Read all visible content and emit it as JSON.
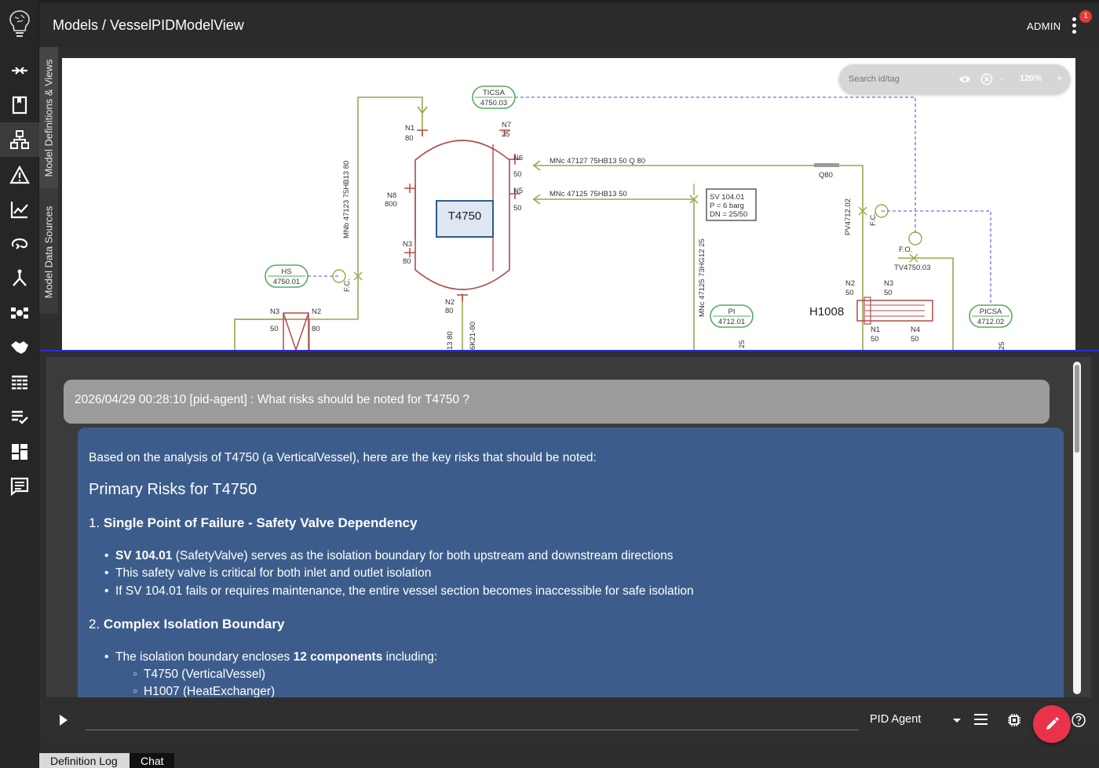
{
  "header": {
    "breadcrumb": "Models / VesselPIDModelView",
    "user": "ADMIN",
    "notification_count": "1"
  },
  "side_tabs": {
    "definitions": "Model Definitions & Views",
    "data_sources": "Model Data Sources"
  },
  "rail_icons": [
    "brain-logo-icon",
    "compare-arrows-icon",
    "book-icon",
    "hierarchy-icon",
    "warning-icon",
    "line-chart-icon",
    "loop-icon",
    "fork-icon",
    "graph-nodes-icon",
    "handshake-icon",
    "table-icon",
    "checklist-icon",
    "dashboard-icon",
    "comment-icon"
  ],
  "diagram_toolbar": {
    "search_placeholder": "Search id/tag",
    "zoom_out": "-",
    "zoom": "120%",
    "zoom_in": "+"
  },
  "diagram": {
    "tags": {
      "ticsa": [
        "TICSA",
        "4750.03"
      ],
      "hs": [
        "HS",
        "4750.01"
      ],
      "pi": [
        "PI",
        "4712.01"
      ],
      "picsa": [
        "PICSA",
        "4712.02"
      ]
    },
    "vessel_label": "T4750",
    "exchanger_label": "H1008",
    "sv_box": [
      "SV 104.01",
      "P = 6 barg",
      "DN = 25/50"
    ],
    "texts": {
      "n1": "N1",
      "n1v": "80",
      "n7": "N7",
      "n7v": "25",
      "n6": "N6",
      "n6v": "50",
      "n5": "N5",
      "n5v": "50",
      "n8": "N8",
      "n8v": "800",
      "n3": "N3",
      "n3v": "80",
      "n2": "N2",
      "n2v": "80",
      "line1": "MNc 47127 75HB13 50 Q 80",
      "line2": "MNc 47125 75HB13 50",
      "line_v1": "MNb 47123 75HB13 80",
      "line_v2": "MNc 47125 73HG12 25",
      "q80": "Q80",
      "pv": "PV4712.02",
      "fc": "F.C.",
      "fo": "F.O.",
      "tv": "TV4750.03",
      "h_n2": "N2",
      "h_n2v": "50",
      "h_n3": "N3",
      "h_n3v": "50",
      "h_n1": "N1",
      "h_n1v": "50",
      "h_n4": "N4",
      "h_n4v": "50",
      "l_n3": "N3",
      "l_n3v": "50",
      "l_n2": "N2",
      "l_n2v": "80",
      "b25a": "25",
      "b25b": "25",
      "b13": "13 80",
      "b6k": "6K21-80"
    }
  },
  "chat": {
    "question": "2026/04/29 00:28:10 [pid-agent] : What risks should be noted for T4750 ?",
    "answer": {
      "intro": "Based on the analysis of T4750 (a VerticalVessel), here are the key risks that should be noted:",
      "heading": "Primary Risks for T4750",
      "section1": {
        "num": "1.",
        "title": "Single Point of Failure - Safety Valve Dependency",
        "b1_bold": "SV 104.01",
        "b1_rest": " (SafetyValve) serves as the isolation boundary for both upstream and downstream directions",
        "b2": "This safety valve is critical for both inlet and outlet isolation",
        "b3": "If SV 104.01 fails or requires maintenance, the entire vessel section becomes inaccessible for safe isolation"
      },
      "section2": {
        "num": "2.",
        "title": "Complex Isolation Boundary",
        "b1_pre": "The isolation boundary encloses ",
        "b1_bold": "12 components",
        "b1_post": " including:",
        "sub1": "T4750 (VerticalVessel)",
        "sub2": "H1007 (HeatExchanger)"
      }
    }
  },
  "input": {
    "placeholder": "",
    "agent": "PID Agent"
  },
  "bottom_tabs": [
    "Definition Log",
    "Chat"
  ],
  "colors": {
    "accent": "#e8334a",
    "answer_bg": "#3c5d8c",
    "question_bg": "#9b9b9b",
    "pipe": "#9aa64a",
    "vessel": "#b04a4a",
    "tag_bubble": "#5aa860",
    "signal": "#6a6ae0"
  }
}
